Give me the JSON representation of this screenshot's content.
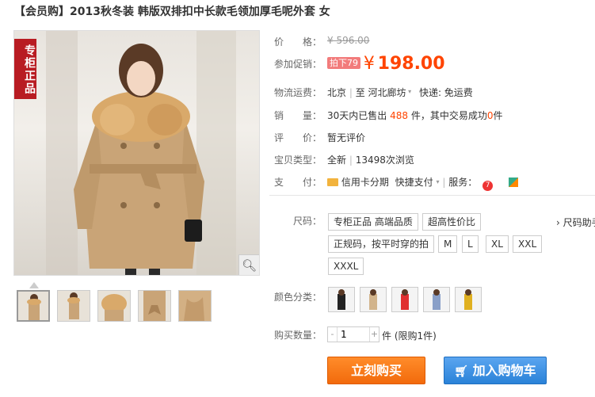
{
  "title": "【会员购】2013秋冬装 韩版双排扣中长款毛领加厚毛呢外套 女",
  "gallery": {
    "tag": "专柜正品",
    "zoom_icon": "magnifier-icon",
    "thumb_count": 5
  },
  "price": {
    "label": "价　　格：",
    "original": "¥ 596.00"
  },
  "promo": {
    "label": "参加促销：",
    "badge": "拍下79",
    "currency": "¥",
    "price": "198.00"
  },
  "shipping": {
    "label": "物流运费：",
    "from": "北京",
    "to_sep": "至",
    "to": "河北廊坊",
    "express": "快递: 免运费"
  },
  "sales": {
    "label": "销　　量：",
    "pre": "30天内已售出",
    "sold": "488",
    "mid": "件，其中交易成功",
    "success": "0",
    "post": "件"
  },
  "rating": {
    "label": "评　　价：",
    "value": "暂无评价"
  },
  "item_type": {
    "label": "宝贝类型：",
    "condition": "全新",
    "views": "13498次浏览"
  },
  "payment": {
    "label": "支　　付：",
    "credit": "信用卡分期",
    "quick": "快捷支付",
    "service_label": "服务："
  },
  "size": {
    "label": "尺码：",
    "help": "尺码助手",
    "options": [
      "专柜正品 高端品质",
      "超高性价比",
      "正规码，按平时穿的拍",
      "M",
      "L",
      "XL",
      "XXL",
      "XXXL"
    ]
  },
  "color": {
    "label": "颜色分类：",
    "swatches": [
      "#222222",
      "#d2b48c",
      "#e03030",
      "#8aa0c8",
      "#e0b020"
    ]
  },
  "quantity": {
    "label": "购买数量：",
    "value": "1",
    "limit": "件 (限购1件)"
  },
  "buttons": {
    "buy": "立刻购买",
    "cart": "加入购物车"
  },
  "colors": {
    "accent": "#ff4400",
    "buy_btn": "#f26a0c",
    "cart_btn": "#2a82d8"
  }
}
